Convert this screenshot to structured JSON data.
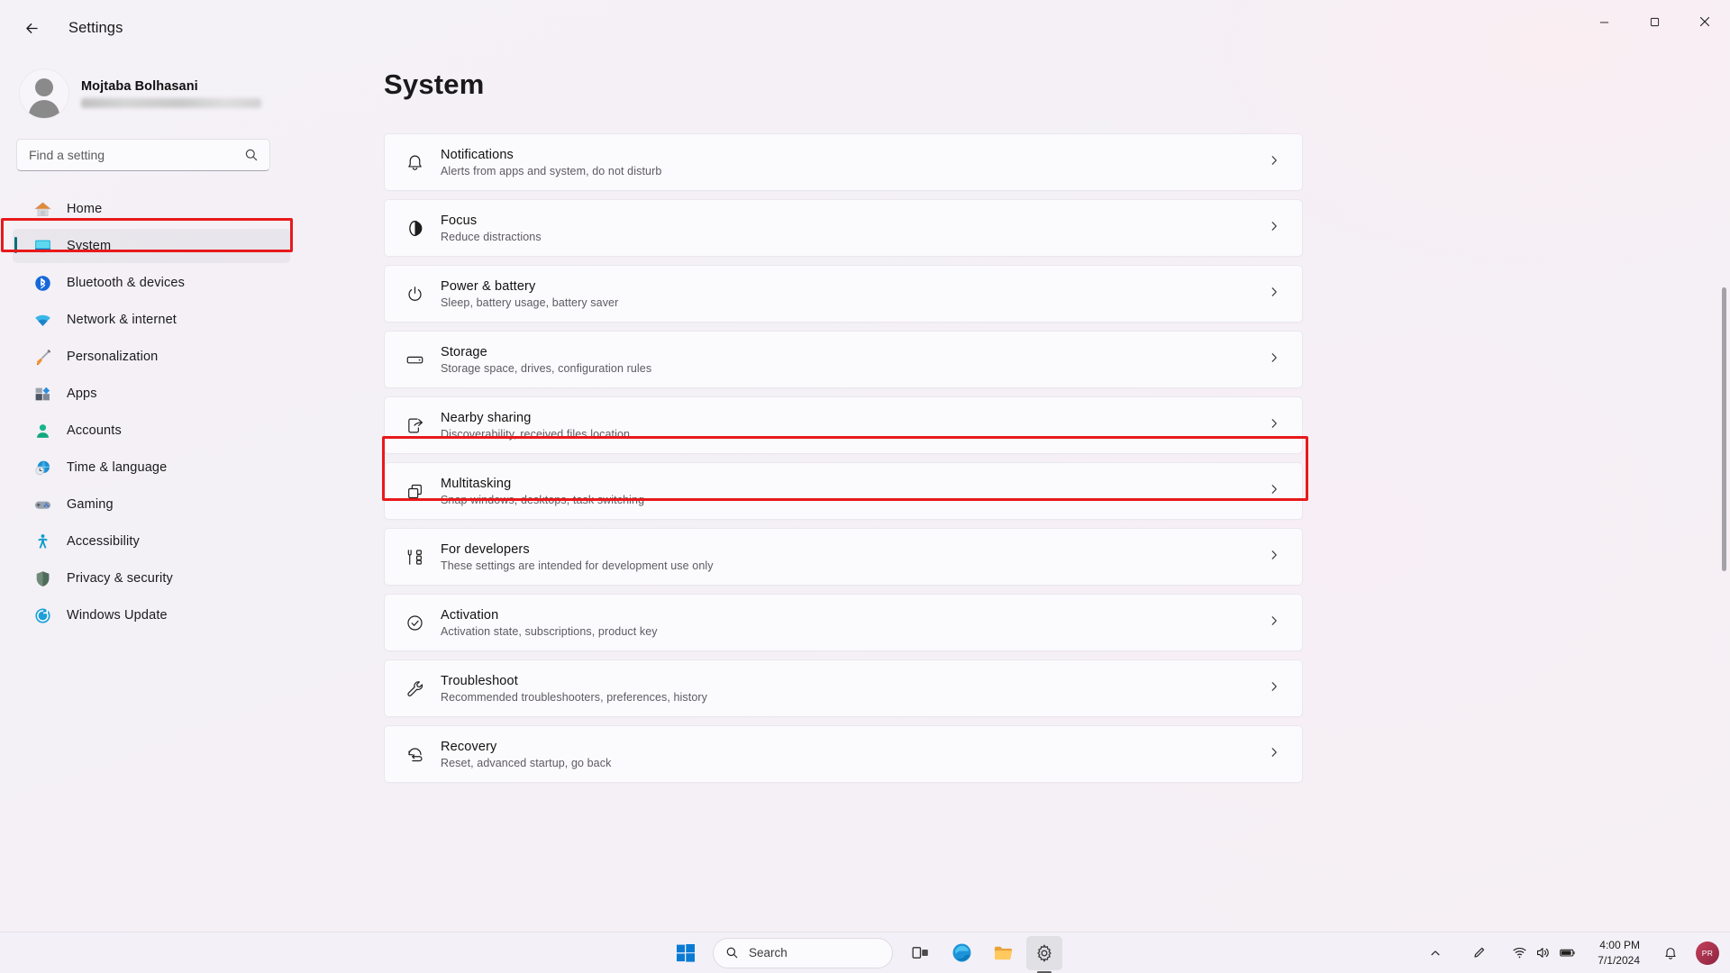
{
  "window": {
    "title": "Settings",
    "back_icon": "back-arrow-icon",
    "minimize_label": "Minimize",
    "maximize_label": "Maximize",
    "close_label": "Close"
  },
  "profile": {
    "name": "Mojtaba Bolhasani",
    "email_redacted": ""
  },
  "search": {
    "placeholder": "Find a setting",
    "value": "",
    "icon": "search-icon"
  },
  "sidebar": {
    "items": [
      {
        "label": "Home",
        "icon": "home-icon",
        "selected": false
      },
      {
        "label": "System",
        "icon": "system-monitor-icon",
        "selected": true
      },
      {
        "label": "Bluetooth & devices",
        "icon": "bluetooth-icon",
        "selected": false
      },
      {
        "label": "Network & internet",
        "icon": "wifi-icon",
        "selected": false
      },
      {
        "label": "Personalization",
        "icon": "paintbrush-icon",
        "selected": false
      },
      {
        "label": "Apps",
        "icon": "apps-icon",
        "selected": false
      },
      {
        "label": "Accounts",
        "icon": "account-icon",
        "selected": false
      },
      {
        "label": "Time & language",
        "icon": "clock-globe-icon",
        "selected": false
      },
      {
        "label": "Gaming",
        "icon": "gamepad-icon",
        "selected": false
      },
      {
        "label": "Accessibility",
        "icon": "accessibility-icon",
        "selected": false
      },
      {
        "label": "Privacy & security",
        "icon": "shield-icon",
        "selected": false
      },
      {
        "label": "Windows Update",
        "icon": "update-icon",
        "selected": false
      }
    ]
  },
  "main": {
    "page_title": "System",
    "cards": [
      {
        "title": "Notifications",
        "subtitle": "Alerts from apps and system, do not disturb",
        "icon": "bell-icon",
        "highlighted": false
      },
      {
        "title": "Focus",
        "subtitle": "Reduce distractions",
        "icon": "focus-icon",
        "highlighted": false
      },
      {
        "title": "Power & battery",
        "subtitle": "Sleep, battery usage, battery saver",
        "icon": "power-icon",
        "highlighted": false
      },
      {
        "title": "Storage",
        "subtitle": "Storage space, drives, configuration rules",
        "icon": "storage-icon",
        "highlighted": false
      },
      {
        "title": "Nearby sharing",
        "subtitle": "Discoverability, received files location",
        "icon": "share-icon",
        "highlighted": false
      },
      {
        "title": "Multitasking",
        "subtitle": "Snap windows, desktops, task switching",
        "icon": "multitasking-icon",
        "highlighted": true
      },
      {
        "title": "For developers",
        "subtitle": "These settings are intended for development use only",
        "icon": "developer-tools-icon",
        "highlighted": false
      },
      {
        "title": "Activation",
        "subtitle": "Activation state, subscriptions, product key",
        "icon": "check-circle-icon",
        "highlighted": false
      },
      {
        "title": "Troubleshoot",
        "subtitle": "Recommended troubleshooters, preferences, history",
        "icon": "wrench-icon",
        "highlighted": false
      },
      {
        "title": "Recovery",
        "subtitle": "Reset, advanced startup, go back",
        "icon": "recovery-icon",
        "highlighted": false
      }
    ],
    "chevron_icon": "chevron-right-icon"
  },
  "annotations": {
    "color": "#e8191b",
    "targets": [
      "System",
      "Multitasking"
    ]
  },
  "taskbar": {
    "start_label": "Start",
    "search_placeholder": "Search",
    "search_icon": "search-icon",
    "buttons": [
      {
        "name": "task-view",
        "label": "Task view"
      },
      {
        "name": "edge",
        "label": "Microsoft Edge"
      },
      {
        "name": "file-explorer",
        "label": "File Explorer"
      },
      {
        "name": "settings",
        "label": "Settings",
        "active": true
      }
    ],
    "tray": {
      "chevron_label": "Show hidden icons",
      "pen_label": "Pen menu",
      "network_label": "Network",
      "volume_label": "Volume",
      "battery_label": "Battery"
    },
    "clock": {
      "time": "4:00 PM",
      "date": "7/1/2024"
    },
    "notification_icon": "bell-icon",
    "avatar_initials": "PR"
  }
}
